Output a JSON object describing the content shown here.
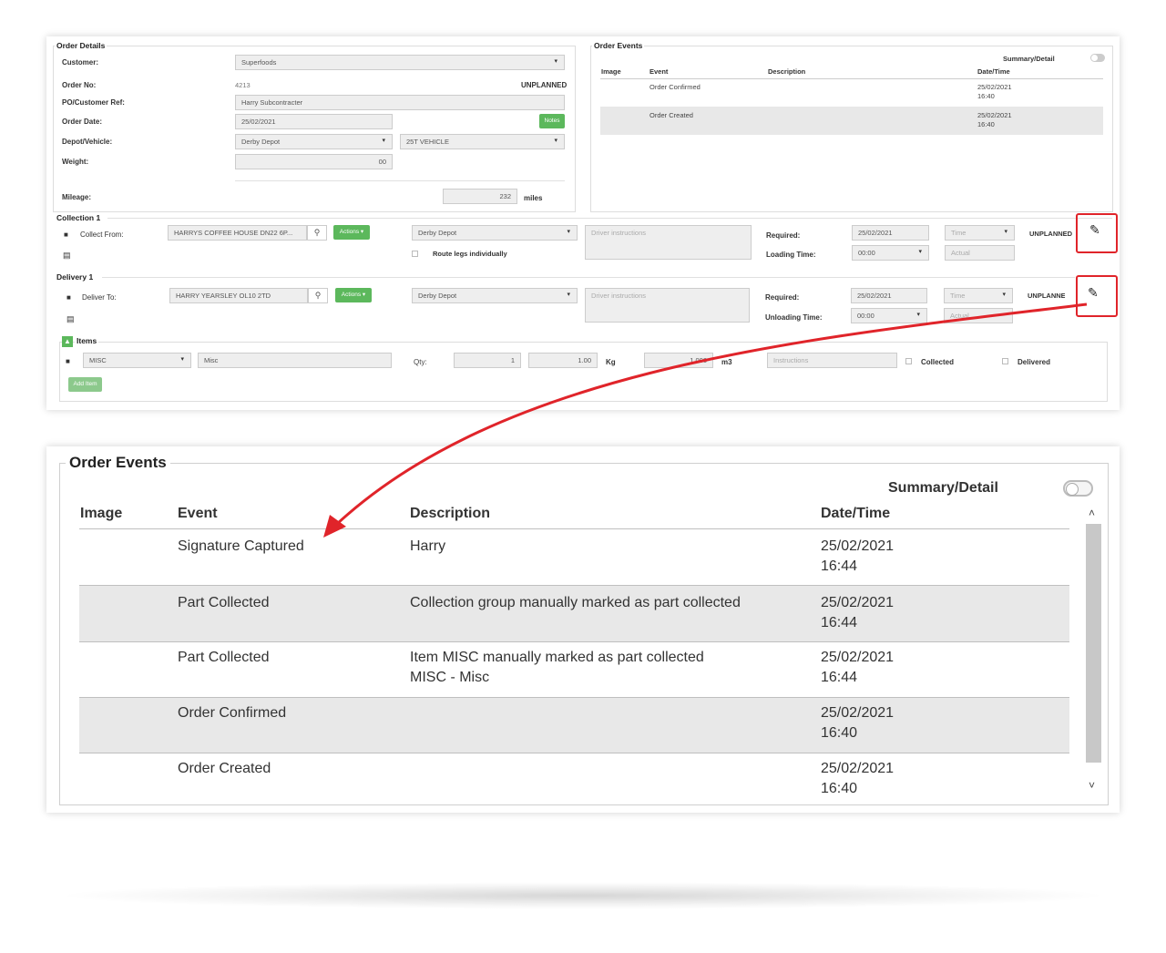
{
  "order_details": {
    "legend": "Order Details",
    "customer_label": "Customer:",
    "customer_value": "Superfoods",
    "order_no_label": "Order No:",
    "order_no_value": "4213",
    "status": "UNPLANNED",
    "po_label": "PO/Customer Ref:",
    "po_value": "Harry Subcontracter",
    "order_date_label": "Order Date:",
    "order_date_value": "25/02/2021",
    "notes_button": "Notes",
    "depot_label": "Depot/Vehicle:",
    "depot_value": "Derby Depot",
    "vehicle_value": "25T VEHICLE",
    "weight_label": "Weight:",
    "weight_value": "00",
    "mileage_label": "Mileage:",
    "mileage_value": "232",
    "mileage_unit": "miles"
  },
  "small_events": {
    "legend": "Order Events",
    "summary_detail": "Summary/Detail",
    "headers": {
      "image": "Image",
      "event": "Event",
      "description": "Description",
      "datetime": "Date/Time"
    },
    "rows": [
      {
        "event": "Order Confirmed",
        "date": "25/02/2021",
        "time": "16:40"
      },
      {
        "event": "Order Created",
        "date": "25/02/2021",
        "time": "16:40"
      }
    ]
  },
  "collection": {
    "legend": "Collection 1",
    "from_label": "Collect From:",
    "from_value": "HARRYS COFFEE HOUSE  DN22 6P...",
    "actions": "Actions ▾",
    "depot": "Derby Depot",
    "route_legs": "Route legs individually",
    "driver_placeholder": "Driver instructions",
    "required_label": "Required:",
    "required_date": "25/02/2021",
    "time_placeholder": "Time",
    "status": "UNPLANNED",
    "loading_label": "Loading Time:",
    "loading_value": "00:00",
    "actual_placeholder": "Actual"
  },
  "delivery": {
    "legend": "Delivery 1",
    "to_label": "Deliver To:",
    "to_value": "HARRY YEARSLEY  OL10 2TD",
    "actions": "Actions ▾",
    "depot": "Derby Depot",
    "driver_placeholder": "Driver instructions",
    "required_label": "Required:",
    "required_date": "25/02/2021",
    "time_placeholder": "Time",
    "status": "UNPLANNED",
    "unloading_label": "Unloading Time:",
    "unloading_value": "00:00",
    "actual_placeholder": "Actual"
  },
  "items": {
    "legend": "Items",
    "type_value": "MISC",
    "desc_value": "Misc",
    "qty_label": "Qty:",
    "qty_value": "1",
    "weight_value": "1.00",
    "weight_unit": "Kg",
    "volume_value": "1.000",
    "volume_unit": "m3",
    "instructions_placeholder": "Instructions",
    "collected_label": "Collected",
    "delivered_label": "Delivered",
    "add_item": "Add Item"
  },
  "big_events": {
    "legend": "Order Events",
    "summary_detail": "Summary/Detail",
    "headers": {
      "image": "Image",
      "event": "Event",
      "description": "Description",
      "datetime": "Date/Time"
    },
    "rows": [
      {
        "event": "Signature Captured",
        "desc1": "Harry",
        "desc2": "",
        "date": "25/02/2021",
        "time": "16:44"
      },
      {
        "event": "Part Collected",
        "desc1": "Collection group manually marked as part collected",
        "desc2": "",
        "date": "25/02/2021",
        "time": "16:44"
      },
      {
        "event": "Part Collected",
        "desc1": "Item MISC manually marked as part collected",
        "desc2": "MISC - Misc",
        "date": "25/02/2021",
        "time": "16:44"
      },
      {
        "event": "Order Confirmed",
        "desc1": "",
        "desc2": "",
        "date": "25/02/2021",
        "time": "16:40"
      },
      {
        "event": "Order Created",
        "desc1": "",
        "desc2": "",
        "date": "25/02/2021",
        "time": "16:40"
      }
    ]
  },
  "icons": {
    "edit": "pencil-icon",
    "search": "search-icon",
    "trash": "trash-icon",
    "calendar": "calendar-icon",
    "chevron_up": "chevron-up-icon",
    "chevron_down": "chevron-down-icon"
  },
  "colors": {
    "accent_green": "#5cb85c",
    "highlight_red": "#e0242a",
    "row_shade": "#e8e8e8"
  }
}
